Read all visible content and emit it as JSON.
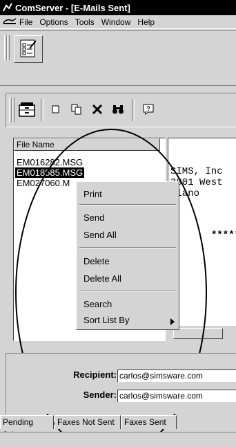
{
  "window": {
    "title": "ComServer - [E-Mails Sent]"
  },
  "menu": {
    "items": [
      "File",
      "Options",
      "Tools",
      "Window",
      "Help"
    ]
  },
  "list": {
    "header": "File Name",
    "rows": [
      "EM016282.MSG",
      "EM018585.MSG",
      "EM027060.M"
    ]
  },
  "preview": {
    "lines": [
      "SIMS, Inc",
      "3801 West",
      "Plano",
      "******"
    ]
  },
  "context_menu": {
    "items": [
      "Print",
      "Send",
      "Send All",
      "Delete",
      "Delete All",
      "Search",
      "Sort List By"
    ]
  },
  "fields": {
    "recipient_label": "Recipient:",
    "recipient_value": "carlos@simsware.com",
    "sender_label": "Sender:",
    "sender_value": "carlos@simsware.com"
  },
  "tabs": [
    "Pending Jobs",
    "Faxes Not Sent",
    "Faxes Sent"
  ]
}
